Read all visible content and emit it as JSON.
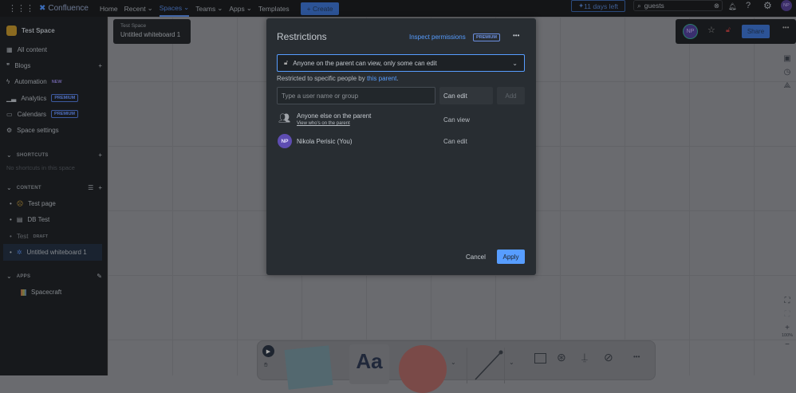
{
  "topbar": {
    "logo": "Confluence",
    "nav": [
      "Home",
      "Recent",
      "Spaces",
      "Teams",
      "Apps",
      "Templates"
    ],
    "create": "Create",
    "trial": "11 days left",
    "search_value": "guests",
    "avatar": "NP"
  },
  "sidebar": {
    "space": "Test Space",
    "items": [
      "All content",
      "Blogs",
      "Automation",
      "Analytics",
      "Calendars",
      "Space settings"
    ],
    "badges": {
      "automation": "NEW",
      "analytics": "PREMIUM",
      "calendars": "PREMIUM"
    },
    "shortcuts": "SHORTCUTS",
    "no_shortcuts": "No shortcuts in this space",
    "content": "CONTENT",
    "pages": [
      "Test page",
      "DB Test",
      "Test",
      "Untitled whiteboard 1"
    ],
    "draft": "DRAFT",
    "apps": "APPS",
    "app_items": [
      "Spacecraft"
    ]
  },
  "breadcrumb": {
    "space": "Test Space",
    "page": "Untitled whiteboard 1"
  },
  "header": {
    "avatar": "NP",
    "share": "Share"
  },
  "modal": {
    "title": "Restrictions",
    "inspect": "Inspect permissions",
    "premium": "PREMIUM",
    "select": "Anyone on the parent can view, only some can edit",
    "restricted_prefix": "Restricted to specific people by ",
    "restricted_link": "this parent",
    "restricted_suffix": ".",
    "input_placeholder": "Type a user name or group",
    "perm": "Can edit",
    "add": "Add",
    "rows": [
      {
        "name": "Anyone else on the parent",
        "sub": "View who's on the parent",
        "perm": "Can view"
      },
      {
        "avatar": "NP",
        "name": "Nikola Perisic (You)",
        "perm": "Can edit"
      }
    ],
    "cancel": "Cancel",
    "apply": "Apply"
  },
  "zoom": "100%",
  "toolbar": {
    "text": "Aa"
  }
}
